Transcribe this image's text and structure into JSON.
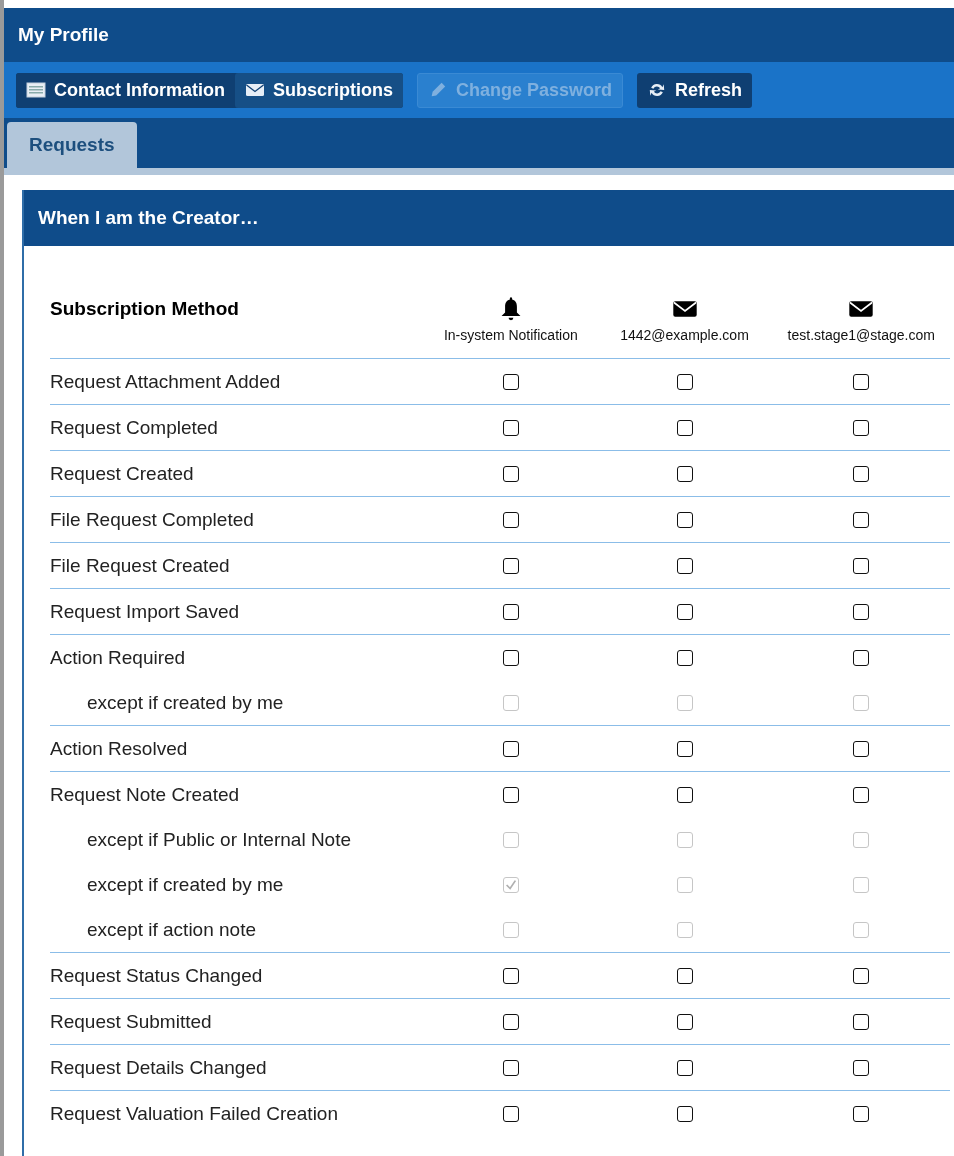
{
  "window": {
    "title": "My Profile"
  },
  "toolbar": {
    "views": [
      {
        "label": "Contact Information",
        "kind": "card",
        "selected": false
      },
      {
        "label": "Subscriptions",
        "kind": "mail",
        "selected": true
      }
    ],
    "actions": [
      {
        "label": "Change Password",
        "kind": "pencil",
        "disabled": true
      },
      {
        "label": "Refresh",
        "kind": "refresh",
        "disabled": false
      }
    ]
  },
  "tabs": [
    {
      "label": "Requests",
      "selected": true
    }
  ],
  "panel": {
    "title": "When I am the Creator…",
    "header": "Subscription Method",
    "columns": [
      {
        "label": "In-system Notification",
        "kind": "bell"
      },
      {
        "label": "1442@example.com",
        "kind": "mail"
      },
      {
        "label": "test.stage1@stage.com",
        "kind": "mail"
      }
    ],
    "rows": [
      {
        "label": "Request Attachment Added",
        "checks": [
          false,
          false,
          false
        ],
        "disabled": false
      },
      {
        "label": "Request Completed",
        "checks": [
          false,
          false,
          false
        ],
        "disabled": false
      },
      {
        "label": "Request Created",
        "checks": [
          false,
          false,
          false
        ],
        "disabled": false
      },
      {
        "label": "File Request Completed",
        "checks": [
          false,
          false,
          false
        ],
        "disabled": false
      },
      {
        "label": "File Request Created",
        "checks": [
          false,
          false,
          false
        ],
        "disabled": false
      },
      {
        "label": "Request Import Saved",
        "checks": [
          false,
          false,
          false
        ],
        "disabled": false
      },
      {
        "label": "Action Required",
        "checks": [
          false,
          false,
          false
        ],
        "disabled": false,
        "children": [
          {
            "label": "except if created by me",
            "checks": [
              false,
              false,
              false
            ],
            "disabled": true
          }
        ]
      },
      {
        "label": "Action Resolved",
        "checks": [
          false,
          false,
          false
        ],
        "disabled": false
      },
      {
        "label": "Request Note Created",
        "checks": [
          false,
          false,
          false
        ],
        "disabled": false,
        "children": [
          {
            "label": "except if Public or Internal Note",
            "checks": [
              false,
              false,
              false
            ],
            "disabled": true
          },
          {
            "label": "except if created by me",
            "checks": [
              true,
              false,
              false
            ],
            "disabled": true
          },
          {
            "label": "except if action note",
            "checks": [
              false,
              false,
              false
            ],
            "disabled": true
          }
        ]
      },
      {
        "label": "Request Status Changed",
        "checks": [
          false,
          false,
          false
        ],
        "disabled": false
      },
      {
        "label": "Request Submitted",
        "checks": [
          false,
          false,
          false
        ],
        "disabled": false
      },
      {
        "label": "Request Details Changed",
        "checks": [
          false,
          false,
          false
        ],
        "disabled": false
      },
      {
        "label": "Request Valuation Failed Creation",
        "checks": [
          false,
          false,
          false
        ],
        "disabled": false
      }
    ]
  }
}
